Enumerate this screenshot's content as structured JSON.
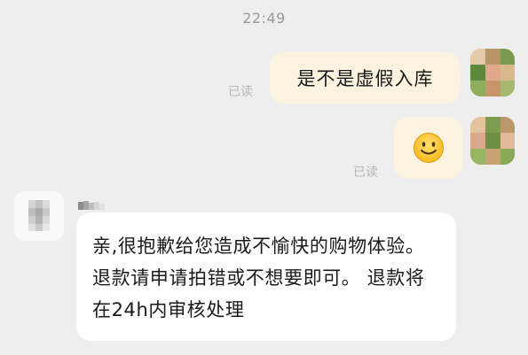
{
  "timestamp": "22:49",
  "messages": [
    {
      "direction": "outgoing",
      "text": "是不是虚假入库",
      "read_status": "已读"
    },
    {
      "direction": "outgoing",
      "content_icon": "smile-emoji-icon",
      "read_status": "已读"
    },
    {
      "direction": "incoming",
      "text": "亲,很抱歉给您造成不愉快的购物体验。退款请申请拍错或不想要即可。 退款将在24h内审核处理"
    }
  ],
  "colors": {
    "background": "#eeeeee",
    "outgoing_bubble": "#fbf3df",
    "incoming_bubble": "#ffffff",
    "read_status": "#b6b6b6",
    "timestamp": "#999999"
  }
}
